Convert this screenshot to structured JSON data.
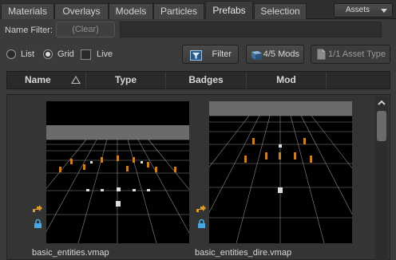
{
  "tabs": [
    {
      "label": "Materials",
      "active": false
    },
    {
      "label": "Overlays",
      "active": false
    },
    {
      "label": "Models",
      "active": false
    },
    {
      "label": "Particles",
      "active": false
    },
    {
      "label": "Prefabs",
      "active": true
    },
    {
      "label": "Selection",
      "active": false
    }
  ],
  "assets_button": {
    "label": "Assets",
    "icon": "chevron-down-icon"
  },
  "name_filter": {
    "label": "Name Filter:",
    "clear_label": "(Clear)",
    "value": ""
  },
  "view_options": {
    "list_label": "List",
    "grid_label": "Grid",
    "selected": "Grid",
    "live_label": "Live",
    "live_checked": false
  },
  "toolbar": {
    "filter_label": "Filter",
    "mods_label": "4/5 Mods",
    "asset_type_label": "1/1 Asset Type"
  },
  "columns": [
    "Name",
    "Type",
    "Badges",
    "Mod"
  ],
  "sort": {
    "column": "Name",
    "direction": "ascending"
  },
  "items": [
    {
      "name": "basic_entities.vmap",
      "badges": [
        "prefab-link-icon",
        "lock-icon"
      ]
    },
    {
      "name": "basic_entities_dire.vmap",
      "badges": [
        "prefab-link-icon",
        "lock-icon"
      ]
    }
  ],
  "colors": {
    "background": "#3b3b3b",
    "panel": "#2a2a2a",
    "badge_orange": "#e09a2a",
    "badge_blue": "#4aa8e0"
  }
}
